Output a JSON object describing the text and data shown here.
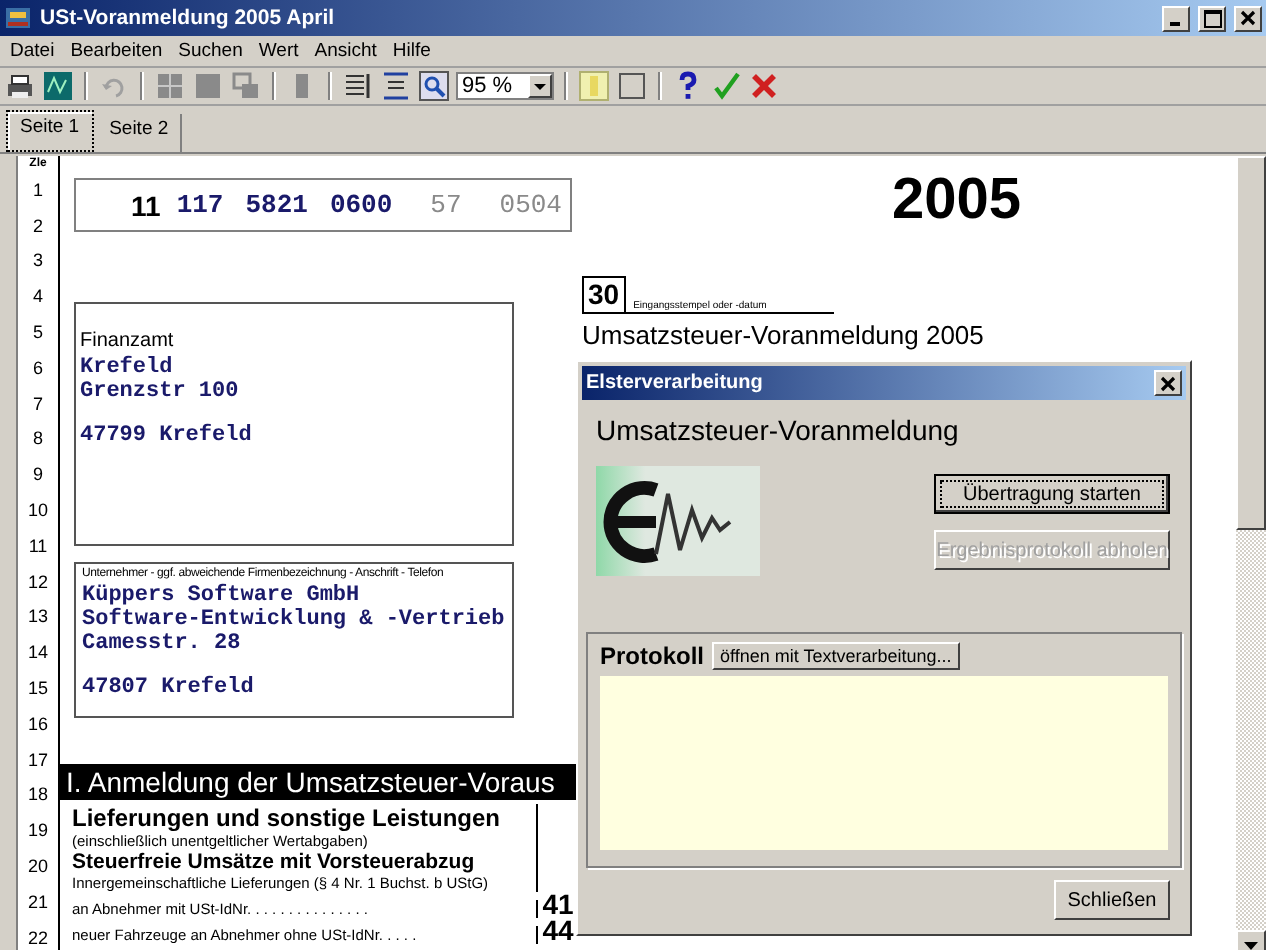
{
  "window": {
    "title": "USt-Voranmeldung 2005 April"
  },
  "menu": [
    "Datei",
    "Bearbeiten",
    "Suchen",
    "Wert",
    "Ansicht",
    "Hilfe"
  ],
  "toolbar": {
    "zoom": "95 %"
  },
  "tabs": [
    {
      "label": "Seite 1",
      "selected": true
    },
    {
      "label": "Seite 2",
      "selected": false
    }
  ],
  "form": {
    "line_header": "Zle",
    "line_numbers": [
      "1",
      "2",
      "3",
      "4",
      "5",
      "6",
      "7",
      "8",
      "9",
      "10",
      "11",
      "12",
      "13",
      "14",
      "15",
      "16",
      "17",
      "18",
      "19",
      "20",
      "21",
      "22"
    ],
    "tax_number": [
      {
        "text": "11",
        "kind": "bold"
      },
      {
        "text": "117",
        "kind": "value"
      },
      {
        "text": "5821",
        "kind": "value"
      },
      {
        "text": "0600",
        "kind": "value"
      },
      {
        "text": "57",
        "kind": "muted"
      },
      {
        "text": "0504",
        "kind": "muted"
      }
    ],
    "year": "2005",
    "box_number": "30",
    "box_caption": "Eingangsstempel oder -datum",
    "form_title": "Umsatzsteuer-Voranmeldung 2005",
    "office": {
      "label": "Finanzamt",
      "lines": [
        "Krefeld",
        "Grenzstr 100"
      ],
      "postal": "47799 Krefeld"
    },
    "company": {
      "caption": "Unternehmer - ggf. abweichende Firmenbezeichnung - Anschrift - Telefon",
      "lines": [
        "Küppers Software GmbH",
        "Software-Entwicklung & -Vertrieb",
        "Camesstr. 28"
      ],
      "postal": "47807 Krefeld"
    },
    "section_heading": "I. Anmeldung der Umsatzsteuer-Voraus",
    "rows": [
      {
        "kind": "heading",
        "text": "Lieferungen und sonstige Leistungen"
      },
      {
        "kind": "note",
        "text": "(einschließlich unentgeltlicher Wertabgaben)"
      },
      {
        "kind": "subheading",
        "text": "Steuerfreie Umsätze mit Vorsteuerabzug"
      },
      {
        "kind": "item",
        "text": "Innergemeinschaftliche Lieferungen (§ 4 Nr. 1 Buchst. b UStG)"
      },
      {
        "kind": "item",
        "text": "an Abnehmer mit USt-IdNr. . .     . . . .     . . . .     . . . .",
        "code": "41"
      },
      {
        "kind": "item",
        "text": "neuer Fahrzeuge an Abnehmer ohne USt-IdNr.  . . . .",
        "code": "44"
      }
    ]
  },
  "dialog": {
    "title": "Elsterverarbeitung",
    "heading": "Umsatzsteuer-Voranmeldung",
    "buttons": [
      {
        "label": "Übertragung starten",
        "disabled": false,
        "focused": true
      },
      {
        "label": "Ergebnisprotokoll abholen",
        "disabled": true,
        "focused": false
      }
    ],
    "log_label": "Protokoll",
    "log_button": "öffnen mit Textverarbeitung...",
    "close_button": "Schließen"
  }
}
